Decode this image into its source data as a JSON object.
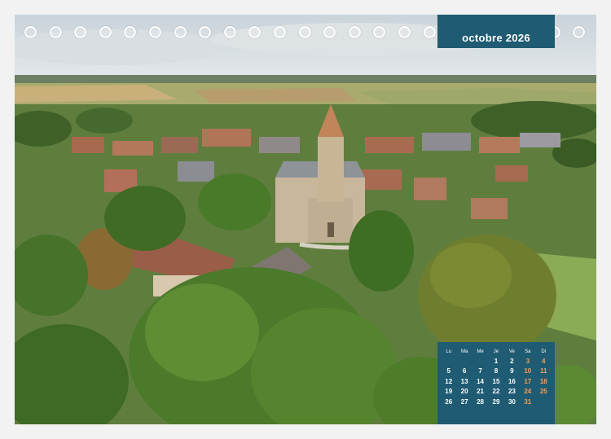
{
  "month_title": "octobre 2026",
  "calendar": {
    "weekdays": [
      "Lu",
      "Ma",
      "Me",
      "Je",
      "Ve",
      "Sa",
      "Di"
    ],
    "weeks": [
      [
        "",
        "",
        "",
        "1",
        "2",
        "3",
        "4"
      ],
      [
        "5",
        "6",
        "7",
        "8",
        "9",
        "10",
        "11"
      ],
      [
        "12",
        "13",
        "14",
        "15",
        "16",
        "17",
        "18"
      ],
      [
        "19",
        "20",
        "21",
        "22",
        "23",
        "24",
        "25"
      ],
      [
        "26",
        "27",
        "28",
        "29",
        "30",
        "31",
        ""
      ]
    ]
  },
  "colors": {
    "panel": "#1f5b72",
    "weekend": "#f2a05a",
    "text": "#ffffff"
  },
  "binding_ring_count": 23
}
